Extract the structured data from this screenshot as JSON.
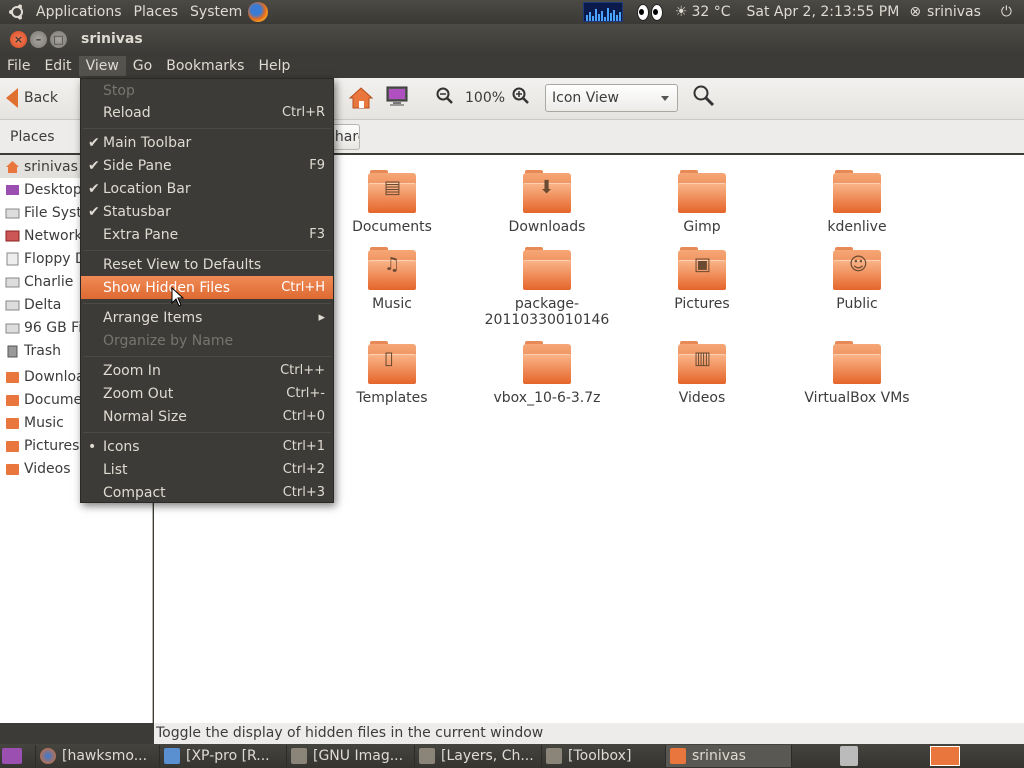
{
  "top_panel": {
    "applications": "Applications",
    "places": "Places",
    "system": "System",
    "weather": "32 °C",
    "clock": "Sat Apr  2,  2:13:55 PM",
    "user": "srinivas"
  },
  "window": {
    "title": "srinivas"
  },
  "menubar": {
    "file": "File",
    "edit": "Edit",
    "view": "View",
    "go": "Go",
    "bookmarks": "Bookmarks",
    "help": "Help"
  },
  "toolbar": {
    "back": "Back",
    "zoom_level": "100%",
    "view_mode": "Icon View"
  },
  "location": {
    "places_label": "Places",
    "share_crumb": "Share"
  },
  "sidebar": {
    "items": [
      "srinivas",
      "Desktop",
      "File System",
      "Network",
      "Floppy Drive",
      "Charlie",
      "Delta",
      "96 GB Filesystem",
      "Trash",
      "Downloads",
      "Documents",
      "Music",
      "Pictures",
      "Videos"
    ]
  },
  "files": [
    {
      "name": "Documents",
      "line2": ""
    },
    {
      "name": "Downloads",
      "line2": ""
    },
    {
      "name": "Gimp",
      "line2": ""
    },
    {
      "name": "kdenlive",
      "line2": ""
    },
    {
      "name": "Music",
      "line2": ""
    },
    {
      "name": "package-",
      "line2": "20110330010146"
    },
    {
      "name": "Pictures",
      "line2": ""
    },
    {
      "name": "Public",
      "line2": ""
    },
    {
      "name": "Templates",
      "line2": ""
    },
    {
      "name": "vbox_10-6-3.7z",
      "line2": ""
    },
    {
      "name": "Videos",
      "line2": ""
    },
    {
      "name": "VirtualBox VMs",
      "line2": ""
    }
  ],
  "view_menu": {
    "stop": "Stop",
    "reload": "Reload",
    "reload_accel": "Ctrl+R",
    "main_toolbar": "Main Toolbar",
    "side_pane": "Side Pane",
    "side_pane_accel": "F9",
    "location_bar": "Location Bar",
    "statusbar": "Statusbar",
    "extra_pane": "Extra Pane",
    "extra_pane_accel": "F3",
    "reset_view": "Reset View to Defaults",
    "show_hidden": "Show Hidden Files",
    "show_hidden_accel": "Ctrl+H",
    "arrange_items": "Arrange Items",
    "organize_by_name": "Organize by Name",
    "zoom_in": "Zoom In",
    "zoom_in_accel": "Ctrl++",
    "zoom_out": "Zoom Out",
    "zoom_out_accel": "Ctrl+-",
    "normal_size": "Normal Size",
    "normal_size_accel": "Ctrl+0",
    "icons": "Icons",
    "icons_accel": "Ctrl+1",
    "list": "List",
    "list_accel": "Ctrl+2",
    "compact": "Compact",
    "compact_accel": "Ctrl+3",
    "check_mark": "✔",
    "radio_mark": "•",
    "submenu_arrow": "▸"
  },
  "statusbar": {
    "text": "Toggle the display of hidden files in the current window"
  },
  "taskbar": {
    "items": [
      "[hawksmo...",
      "[XP-pro [R...",
      "[GNU Imag...",
      "[Layers, Ch...",
      "[Toolbox]",
      "srinivas"
    ]
  },
  "colors": {
    "accent": "#e06d33",
    "panel": "#3c3b37",
    "highlight": "#f07746"
  }
}
